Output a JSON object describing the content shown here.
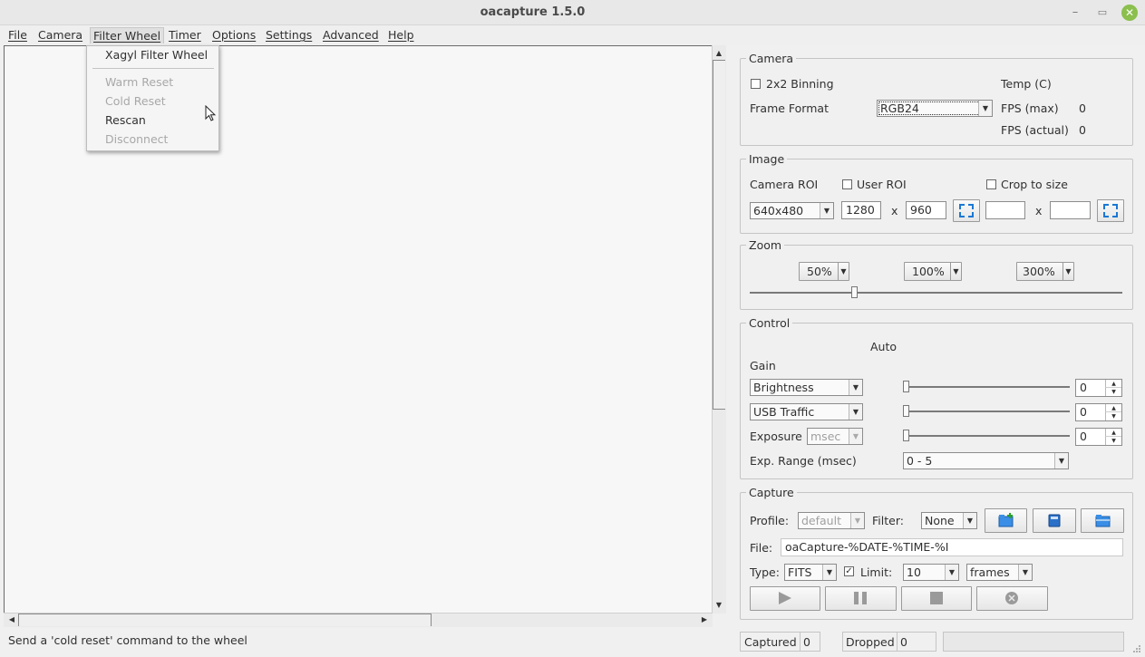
{
  "window": {
    "title": "oacapture 1.5.0",
    "minimize_glyph": "–",
    "maximize_glyph": "▭",
    "close_glyph": "✕"
  },
  "menubar": {
    "items": [
      "File",
      "Camera",
      "Filter Wheel",
      "Timer",
      "Options",
      "Settings",
      "Advanced",
      "Help"
    ],
    "open_menu": "Filter Wheel"
  },
  "filter_wheel_menu": {
    "items": [
      {
        "label": "Xagyl Filter Wheel",
        "enabled": true
      },
      {
        "label": "Warm Reset",
        "enabled": false
      },
      {
        "label": "Cold Reset",
        "enabled": false
      },
      {
        "label": "Rescan",
        "enabled": true
      },
      {
        "label": "Disconnect",
        "enabled": false
      }
    ]
  },
  "status": {
    "text": "Send a 'cold reset' command to the wheel",
    "captured_label": "Captured",
    "captured_value": "0",
    "dropped_label": "Dropped",
    "dropped_value": "0",
    "progress": 0
  },
  "camera": {
    "title": "Camera",
    "binning_label": "2x2 Binning",
    "binning_checked": false,
    "temp_label": "Temp (C)",
    "frame_format_label": "Frame Format",
    "frame_format_value": "RGB24",
    "fps_max_label": "FPS (max)",
    "fps_max_value": "0",
    "fps_actual_label": "FPS (actual)",
    "fps_actual_value": "0"
  },
  "image": {
    "title": "Image",
    "roi_label": "Camera ROI",
    "user_roi_label": "User ROI",
    "crop_label": "Crop to size",
    "roi_value": "640x480",
    "width_value": "1280",
    "x_label": "x",
    "height_value": "960",
    "crop_width_value": "",
    "crop_height_value": ""
  },
  "zoom": {
    "title": "Zoom",
    "presets": [
      "50%",
      "100%",
      "300%"
    ],
    "slider_fraction": 0.28
  },
  "control": {
    "title": "Control",
    "auto_label": "Auto",
    "gain_label": "Gain",
    "rows": [
      {
        "control": "Brightness",
        "value": "0",
        "slider_fraction": 0
      },
      {
        "control": "USB Traffic",
        "value": "0",
        "slider_fraction": 0
      }
    ],
    "exposure_label": "Exposure",
    "exposure_unit": "msec",
    "exposure_value": "0",
    "exp_range_label": "Exp. Range (msec)",
    "exp_range_value": "0 - 5"
  },
  "capture": {
    "title": "Capture",
    "profile_label": "Profile:",
    "profile_value": "default",
    "filter_label": "Filter:",
    "filter_value": "None",
    "file_label": "File:",
    "file_value": "oaCapture-%DATE-%TIME-%I",
    "type_label": "Type:",
    "type_value": "FITS",
    "limit_label": "Limit:",
    "limit_checked": true,
    "limit_value": "10",
    "limit_unit": "frames",
    "buttons": [
      "play-icon",
      "pause-icon",
      "stop-icon",
      "autorun-icon"
    ]
  }
}
